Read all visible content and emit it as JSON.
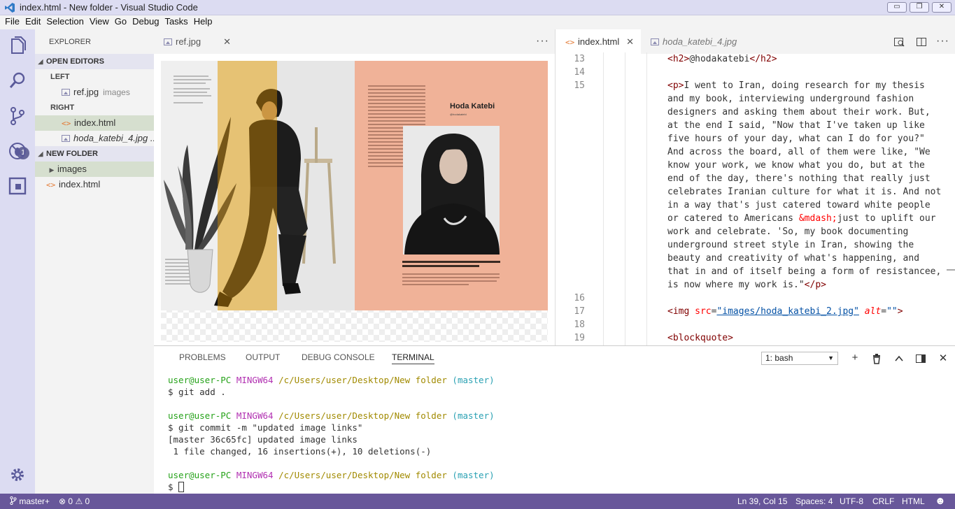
{
  "window": {
    "title": "index.html - New folder - Visual Studio Code",
    "controls": [
      "▭",
      "❐",
      "✕"
    ]
  },
  "menu": [
    "File",
    "Edit",
    "Selection",
    "View",
    "Go",
    "Debug",
    "Tasks",
    "Help"
  ],
  "activity": {
    "scm_badge": "1"
  },
  "sidebar": {
    "header": "EXPLORER",
    "open_editors": "OPEN EDITORS",
    "left": "LEFT",
    "left_file": "ref.jpg",
    "left_file_desc": "images",
    "right": "RIGHT",
    "right_file1": "index.html",
    "right_file2": "hoda_katebi_4.jpg ...",
    "folder": "NEW FOLDER",
    "folder_images": "images",
    "folder_index": "index.html"
  },
  "editor_left": {
    "tab": "ref.jpg",
    "more": "···",
    "preview": {
      "name": "Hoda Katebi",
      "handle": "@hodakatebi",
      "intro": "\" I went to Iran, doing research for my thesis and my book, interviewing underground fashion designers and asking them about their work. But, at the end I said, 'Now that I've taken up like five hours of your day, what can I do for you?' And across the board, all of them were like, 'We know your work, we know what you do, but at the end of the day, there's nothing that really just celebrates Iranian culture for what it is.'",
      "quote": "\"Fashion is a means of communication and can really open doors in different places.\"",
      "bio": "The voice of JooJoo Azad, author of Tehran Streetstyle, and founder of the international online book club Because We've Read, Hoda is unapologetic in exploring and articulating the art, communication, and politics of fashion."
    }
  },
  "editor_right": {
    "tab_active": "index.html",
    "tab_preview": "hoda_katebi_4.jpg",
    "more": "···",
    "lines": {
      "n13": "13",
      "n14": "14",
      "n15": "15",
      "n16": "16",
      "n17": "17",
      "n18": "18",
      "n19": "19"
    },
    "code": {
      "h2_open": "<h2>",
      "h2_text": "@hodakatebi",
      "h2_close": "</h2>",
      "p_open": "<p>",
      "p1": "I went to Iran, doing research for my thesis",
      "p2": "and my book, interviewing underground fashion",
      "p3": "designers and asking them about their work. But,",
      "p4": "at the end I said, \"Now that I've taken up like",
      "p5": "five hours of your day, what can I do for you?\"",
      "p6": "And across the board, all of them were like, \"We",
      "p7": "know your work, we know what you do, but at the",
      "p8": "end of the day, there's nothing that really just",
      "p9": "celebrates Iranian culture for what it is. And not",
      "p10": "in a way that's just catered toward white people",
      "p11a": "or catered to Americans ",
      "p11e": "&mdash;",
      "p11b": "just to uplift our",
      "p12": "work and celebrate. 'So, my book documenting",
      "p13": "underground street style in Iran, showing the",
      "p14": "beauty and creativity of what's happening, and",
      "p15": "that in and of itself being a form of resistancee,",
      "p16": "is now where my work is.\"",
      "p_close": "</p>",
      "img_open": "<img ",
      "img_src_attr": "src",
      "img_src_val": "\"images/hoda_katebi_2.jpg\"",
      "img_alt_attr": "alt",
      "img_alt_val": "\"\"",
      "img_close": ">",
      "bq": "<blockquote>"
    }
  },
  "panel": {
    "tabs": [
      "PROBLEMS",
      "OUTPUT",
      "DEBUG CONSOLE",
      "TERMINAL"
    ],
    "terminal_select": "1: bash",
    "prompt_user": "user@user-PC",
    "prompt_env": "MINGW64",
    "prompt_path": "/c/Users/user/Desktop/New folder",
    "prompt_branch": "(master)",
    "cmd1": "$ git add .",
    "cmd2": "$ git commit -m \"updated image links\"",
    "out1": "[master 36c65fc] updated image links",
    "out2": " 1 file changed, 16 insertions(+), 10 deletions(-)",
    "cmd3": "$ "
  },
  "status": {
    "branch": "master+",
    "errors": "0",
    "warnings": "0",
    "position": "Ln 39, Col 15",
    "spaces": "Spaces: 4",
    "encoding": "UTF-8",
    "eol": "CRLF",
    "language": "HTML",
    "feedback": "☻"
  },
  "colors": {
    "accent": "#68579a",
    "activity_bg": "#dcdcf2",
    "peach": "#f0b298"
  }
}
